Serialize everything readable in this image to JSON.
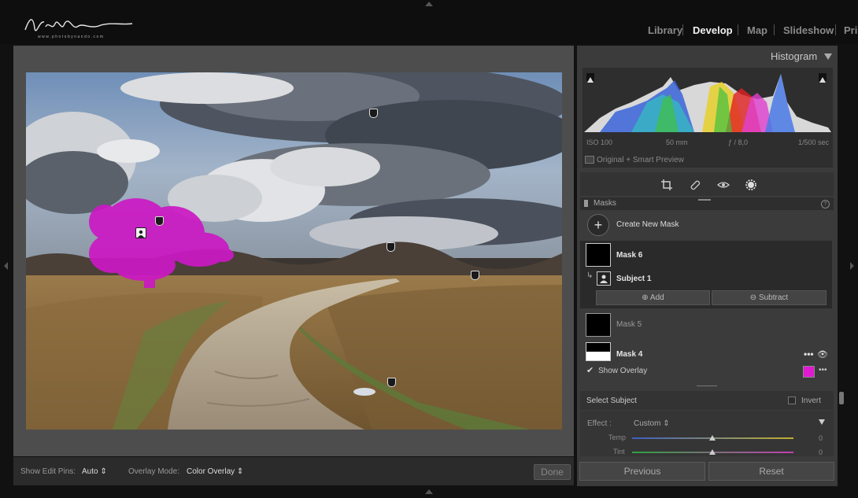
{
  "logo": {
    "signature": "Nando Harmsen",
    "url_text": "www.photobynando.com"
  },
  "modules": [
    "Library",
    "Develop",
    "Map",
    "Slideshow",
    "Prin"
  ],
  "active_module": "Develop",
  "toolbar": {
    "edit_pins_label": "Show Edit Pins:",
    "edit_pins_value": "Auto",
    "overlay_mode_label": "Overlay Mode:",
    "overlay_mode_value": "Color Overlay",
    "done_label": "Done"
  },
  "histogram": {
    "title": "Histogram",
    "iso": "ISO 100",
    "focal": "50 mm",
    "aperture": "ƒ / 8,0",
    "shutter": "1/500 sec",
    "preview_label": "Original + Smart Preview"
  },
  "masks": {
    "title": "Masks",
    "create_label": "Create New Mask",
    "items": [
      {
        "name": "Mask 6",
        "selected": true
      },
      {
        "name": "Mask 5",
        "selected": false
      },
      {
        "name": "Mask 4",
        "selected": false
      }
    ],
    "component": "Subject 1",
    "add_label": "Add",
    "subtract_label": "Subtract",
    "show_overlay_label": "Show Overlay",
    "overlay_color": "#e01ad0"
  },
  "subject": {
    "label": "Select Subject",
    "invert_label": "Invert"
  },
  "effect": {
    "label": "Effect :",
    "preset": "Custom",
    "sliders": [
      {
        "label": "Temp",
        "value": "0",
        "position": 0.5
      },
      {
        "label": "Tint",
        "value": "0",
        "position": 0.5
      }
    ]
  },
  "buttons": {
    "previous": "Previous",
    "reset": "Reset"
  },
  "colors": {
    "accent_mask": "#e01ad0",
    "panel": "#3b3b3b",
    "background": "#0e0e0e"
  }
}
